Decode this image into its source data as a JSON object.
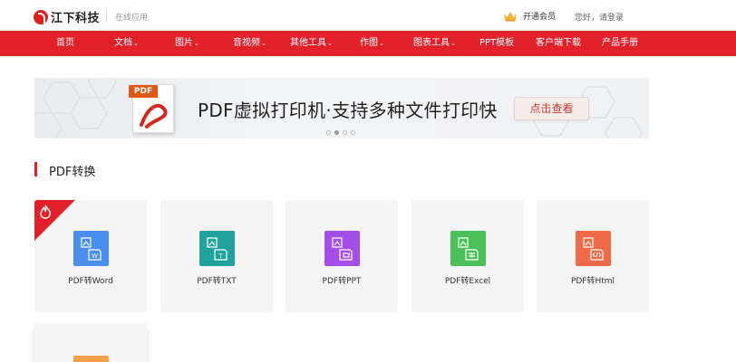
{
  "header": {
    "logo_text": "江下科技",
    "subtitle": "在线应用",
    "vip_label": "开通会员",
    "login_text": "您好，请登录"
  },
  "nav": {
    "items": [
      {
        "label": "首页",
        "dropdown": false
      },
      {
        "label": "文档",
        "dropdown": true
      },
      {
        "label": "图片",
        "dropdown": true
      },
      {
        "label": "音视频",
        "dropdown": true
      },
      {
        "label": "其他工具",
        "dropdown": true
      },
      {
        "label": "作图",
        "dropdown": true
      },
      {
        "label": "图表工具",
        "dropdown": true
      },
      {
        "label": "PPT模板",
        "dropdown": false
      },
      {
        "label": "客户端下载",
        "dropdown": false
      },
      {
        "label": "产品手册",
        "dropdown": false
      }
    ],
    "chevron": "⌄"
  },
  "banner": {
    "pdf_tag": "PDF",
    "title": "PDF虚拟打印机·支持多种文件打印快",
    "button_label": "点击查看",
    "slide_count": 4,
    "active_slide": 1
  },
  "section": {
    "title": "PDF转换"
  },
  "cards": [
    {
      "label": "PDF转Word",
      "icon": "word-file-icon",
      "glyph": "W",
      "color": "#4a8ff0",
      "hot": true
    },
    {
      "label": "PDF转TXT",
      "icon": "txt-file-icon",
      "glyph": "T",
      "color": "#1fa39a",
      "hot": false
    },
    {
      "label": "PDF转PPT",
      "icon": "ppt-file-icon",
      "glyph": "⊡",
      "color": "#a34ee6",
      "hot": false
    },
    {
      "label": "PDF转Excel",
      "icon": "excel-file-icon",
      "glyph": "⊞",
      "color": "#4cc058",
      "hot": false
    },
    {
      "label": "PDF转Html",
      "icon": "html-file-icon",
      "glyph": "</>",
      "color": "#f06a47",
      "hot": false
    }
  ],
  "colors": {
    "brand_red": "#e1202a",
    "partial_card_icon": "#f5a14a"
  }
}
